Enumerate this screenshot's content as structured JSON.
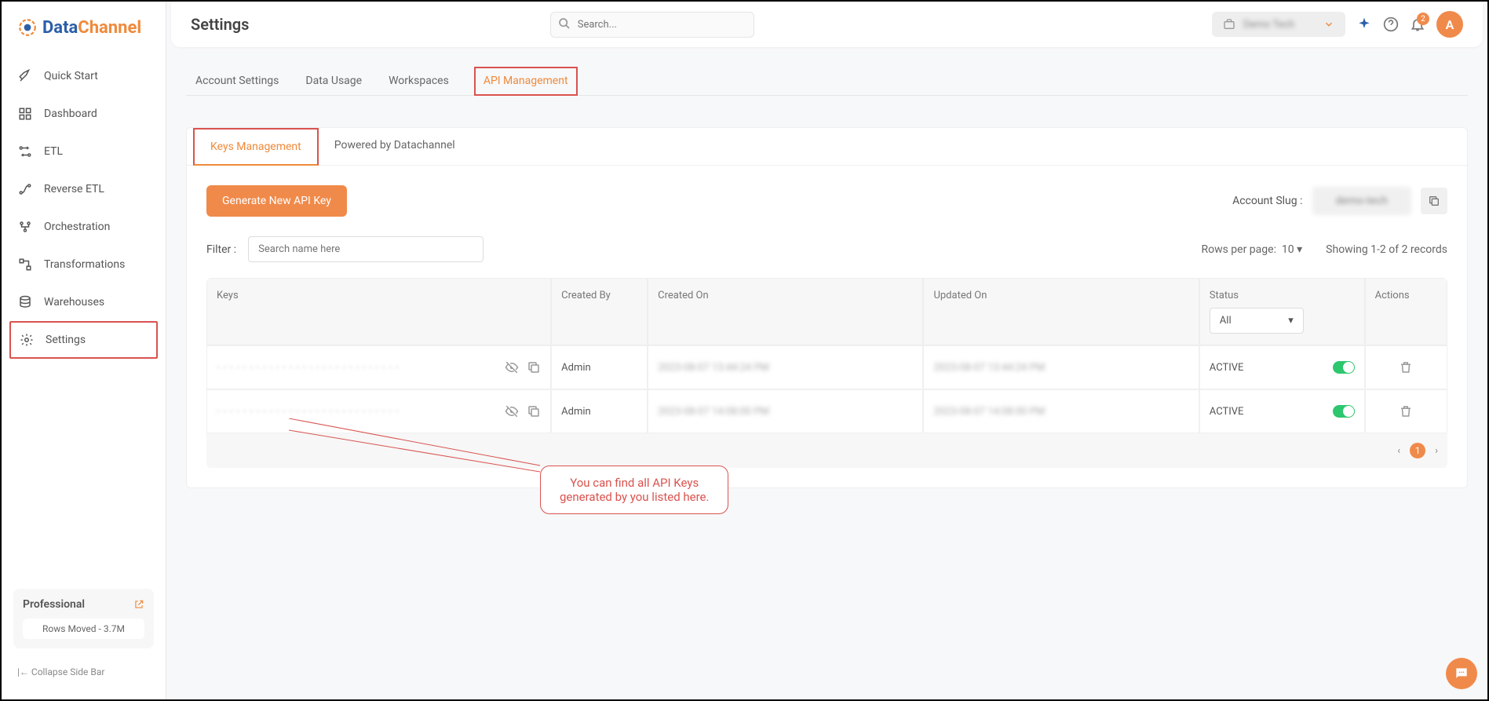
{
  "logo": {
    "part1": "Data",
    "part2": "Channel"
  },
  "sidebar": {
    "items": [
      {
        "label": "Quick Start"
      },
      {
        "label": "Dashboard"
      },
      {
        "label": "ETL"
      },
      {
        "label": "Reverse ETL"
      },
      {
        "label": "Orchestration"
      },
      {
        "label": "Transformations"
      },
      {
        "label": "Warehouses"
      },
      {
        "label": "Settings"
      }
    ],
    "collapse": "Collapse Side Bar"
  },
  "plan": {
    "title": "Professional",
    "subtitle": "Rows Moved - 3.7M"
  },
  "header": {
    "title": "Settings",
    "search_placeholder": "Search...",
    "workspace": "Demo Tech",
    "avatar": "A",
    "notif_count": "2"
  },
  "tabs": [
    {
      "label": "Account Settings"
    },
    {
      "label": "Data Usage"
    },
    {
      "label": "Workspaces"
    },
    {
      "label": "API Management"
    }
  ],
  "subtabs": [
    {
      "label": "Keys Management"
    },
    {
      "label": "Powered by Datachannel"
    }
  ],
  "actions": {
    "generate": "Generate New API Key",
    "slug_label": "Account Slug :",
    "slug_value": "demo-tech"
  },
  "filter": {
    "label": "Filter :",
    "placeholder": "Search name here",
    "rows_label": "Rows per page:",
    "rows_value": "10",
    "showing": "Showing 1-2 of 2 records"
  },
  "table": {
    "headers": {
      "keys": "Keys",
      "created_by": "Created By",
      "created_on": "Created On",
      "updated_on": "Updated On",
      "status": "Status",
      "actions": "Actions"
    },
    "status_filter": "All",
    "rows": [
      {
        "key": "• • • • • • • • • • • • • • • • • • • • • • • • • • • •",
        "created_by": "Admin",
        "created_on": "2023-08-07 13:44:24 PM",
        "updated_on": "2023-08-07 13:44:24 PM",
        "status": "ACTIVE"
      },
      {
        "key": "• • • • • • • • • • • • • • • • • • • • • • • • • • • •",
        "created_by": "Admin",
        "created_on": "2023-08-07 14:08:00 PM",
        "updated_on": "2023-08-07 14:08:00 PM",
        "status": "ACTIVE"
      }
    ]
  },
  "pager": {
    "current": "1"
  },
  "callout": {
    "line1": "You can find all API Keys",
    "line2": "generated by you listed here."
  }
}
